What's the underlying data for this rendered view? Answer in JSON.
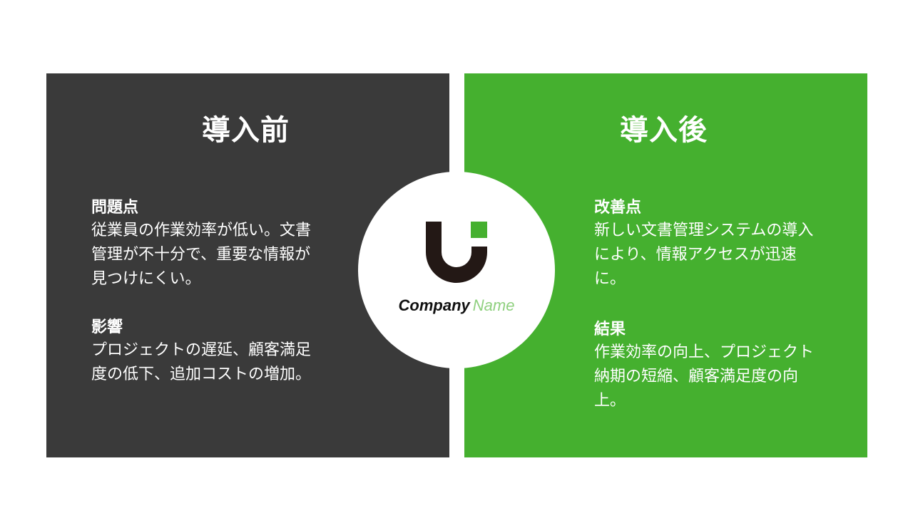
{
  "before": {
    "title": "導入前",
    "problems": {
      "heading": "問題点",
      "body": "従業員の作業効率が低い。文書管理が不十分で、重要な情報が見つけにくい。"
    },
    "impact": {
      "heading": "影響",
      "body": "プロジェクトの遅延、顧客満足度の低下、追加コストの増加。"
    }
  },
  "after": {
    "title": "導入後",
    "improvements": {
      "heading": "改善点",
      "body": "新しい文書管理システムの導入により、情報アクセスが迅速に。"
    },
    "results": {
      "heading": "結果",
      "body": "作業効率の向上、プロジェクト納期の短縮、顧客満足度の向上。"
    }
  },
  "logo": {
    "word_company": "Company",
    "word_name": "Name",
    "icon": "u-letter-logo-icon"
  },
  "colors": {
    "before_panel": "#3a3a3a",
    "after_panel": "#45b02f",
    "logo_dark": "#231815",
    "logo_green": "#45b02f"
  }
}
